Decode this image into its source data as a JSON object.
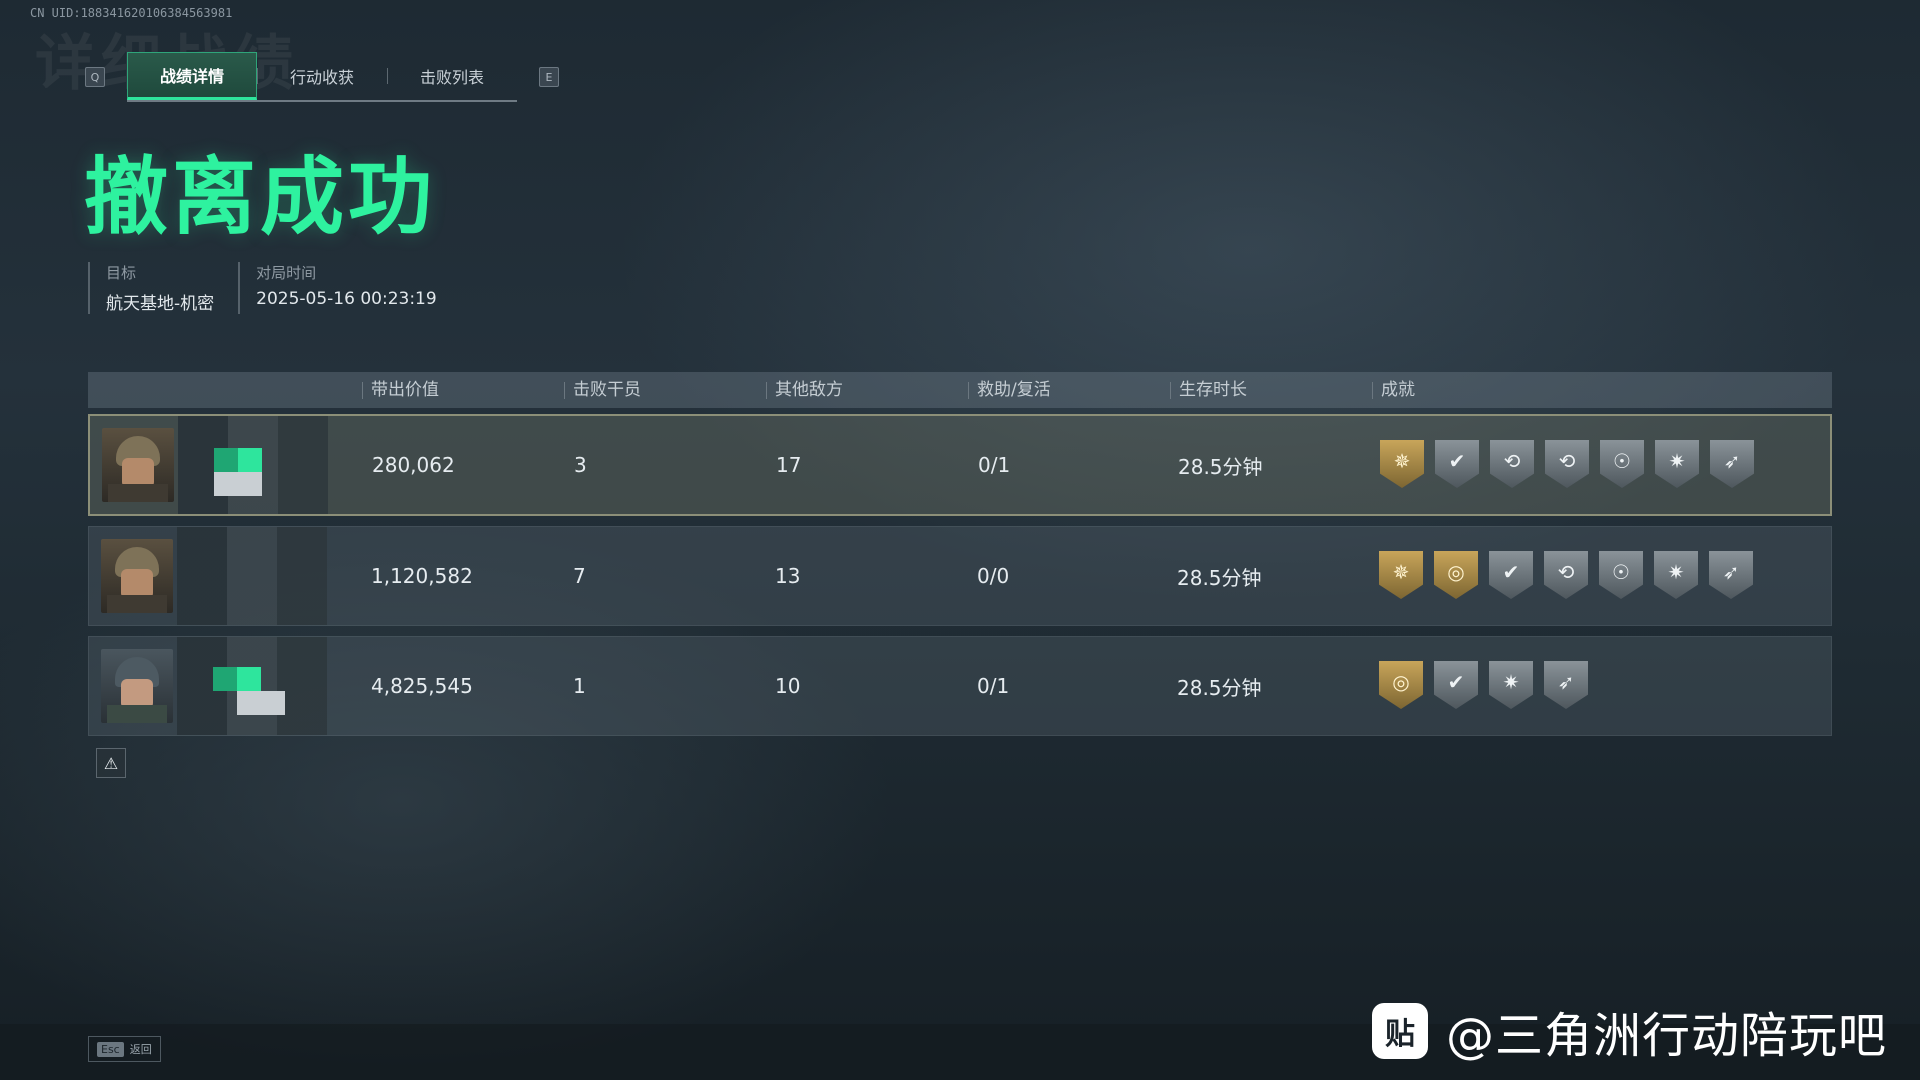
{
  "uid_text": "CN UID:1883416201063845639​81",
  "ghost_title": "详细战绩",
  "tabs": {
    "left_key": "Q",
    "right_key": "E",
    "items": [
      {
        "label": "战绩详情",
        "active": true
      },
      {
        "label": "行动收获",
        "active": false
      },
      {
        "label": "击败列表",
        "active": false
      }
    ]
  },
  "headline": "撤离成功",
  "meta": {
    "target_label": "目标",
    "target_value": "航天基地-机密",
    "time_label": "对局时间",
    "time_value": "2025-05-16 00:23:19"
  },
  "table": {
    "headers": [
      "带出价值",
      "击败干员",
      "其他敌方",
      "救助/复活",
      "生存时长",
      "成就"
    ],
    "rows": [
      {
        "value": "280,062",
        "kills": "3",
        "others": "17",
        "assist": "0/1",
        "survival": "28.5分钟",
        "badges": [
          [
            "gold",
            "✵"
          ],
          [
            "silver",
            "✔"
          ],
          [
            "silver",
            "⟲"
          ],
          [
            "silver",
            "⟲"
          ],
          [
            "silver",
            "☉"
          ],
          [
            "silver",
            "✷"
          ],
          [
            "silver",
            "➶"
          ]
        ]
      },
      {
        "value": "1,120,582",
        "kills": "7",
        "others": "13",
        "assist": "0/0",
        "survival": "28.5分钟",
        "badges": [
          [
            "gold",
            "✵"
          ],
          [
            "gold",
            "◎"
          ],
          [
            "silver",
            "✔"
          ],
          [
            "silver",
            "⟲"
          ],
          [
            "silver",
            "☉"
          ],
          [
            "silver",
            "✷"
          ],
          [
            "silver",
            "➶"
          ]
        ]
      },
      {
        "value": "4,825,545",
        "kills": "1",
        "others": "10",
        "assist": "0/1",
        "survival": "28.5分钟",
        "badges": [
          [
            "gold",
            "◎"
          ],
          [
            "silver",
            "✔"
          ],
          [
            "silver",
            "✷"
          ],
          [
            "silver",
            "➶"
          ]
        ]
      }
    ]
  },
  "warning_icon": "⚠",
  "esc": {
    "key": "Esc",
    "label": "返回"
  },
  "watermark": {
    "logo": "贴",
    "text": "@三角洲行动陪玩吧"
  },
  "colors": {
    "accent": "#2ee59d",
    "gold": "#c8a55a"
  }
}
